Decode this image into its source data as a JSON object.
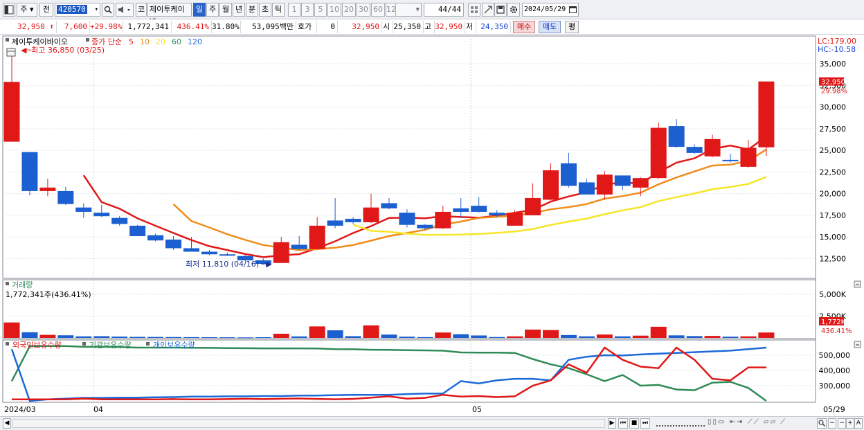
{
  "toolbar": {
    "market_label": "주",
    "prev_label": "전",
    "code": "420570",
    "stock_tag": "코",
    "stock_name": "제이투케이바",
    "periods": [
      {
        "label": "일",
        "selected": true
      },
      {
        "label": "주",
        "selected": false
      },
      {
        "label": "월",
        "selected": false
      },
      {
        "label": "년",
        "selected": false
      },
      {
        "label": "분",
        "selected": false
      },
      {
        "label": "초",
        "selected": false
      },
      {
        "label": "틱",
        "selected": false
      }
    ],
    "intervals": [
      "1",
      "3",
      "5",
      "10",
      "20",
      "30",
      "60",
      "120"
    ],
    "count": "44",
    "count_total": "/44",
    "date": "2024/05/29",
    "icons": [
      "window-icon",
      "search-icon",
      "speaker-icon",
      "grid-icon",
      "crosshair-icon",
      "save-icon",
      "gear-icon",
      "calendar-icon"
    ]
  },
  "info": {
    "price": "32,950",
    "change": "7,600",
    "change_pct": "+29.98%",
    "volume": "1,772,341",
    "volume_pct": "436.41%",
    "turnover": "31.80%",
    "amount": "53,095백만",
    "quote_label": "호가",
    "quote_value": "0",
    "quote_price": "32,950",
    "open_label": "시",
    "open": "25,350",
    "high_label": "고",
    "high": "32,950",
    "low_label": "저",
    "low": "24,350",
    "buy_label": "매수",
    "sell_label": "매도",
    "flat_label": "평"
  },
  "price_panel": {
    "legend_name": "제이투케이바이오",
    "legend_ma_label": "종가 단순",
    "ma_periods": [
      "5",
      "10",
      "20",
      "60",
      "120"
    ],
    "ma_colors": [
      "#e01818",
      "#f08c1c",
      "#f5e628",
      "#2e8b57",
      "#1c6ad8"
    ],
    "high_annotation": "최고 36,850 (03/25)",
    "low_annotation": "최저 11,810 (04/16)",
    "lc": "LC:179.00",
    "hc": "HC:-10.58",
    "axis_ticks": [
      "35,000",
      "32,500",
      "30,000",
      "27,500",
      "25,000",
      "22,500",
      "20,000",
      "17,500",
      "15,000",
      "12,500"
    ],
    "last_price_tag": "32,950",
    "last_pct_tag": "29.98%"
  },
  "volume_panel": {
    "title": "거래량",
    "value": "1,772,341주(436.41%)",
    "axis_ticks": [
      "5,000K",
      "2,500K"
    ],
    "last_tag": "1,772K",
    "last_pct_tag": "436.41%"
  },
  "holdings_panel": {
    "legends": [
      "외국인보유수량",
      "기관보유수량",
      "개인보유수량"
    ],
    "colors": [
      "#e01818",
      "#2e8b57",
      "#1c6ad8"
    ],
    "axis_ticks": [
      "500,000",
      "400,000",
      "300,000"
    ]
  },
  "x_axis": {
    "labels": [
      "2024/03",
      "04",
      "05"
    ],
    "last_label": "05/29"
  },
  "chart_data": {
    "type": "candlestick",
    "candles": [
      {
        "o": 26000,
        "h": 36850,
        "l": 26000,
        "c": 32900
      },
      {
        "o": 24800,
        "h": 24800,
        "l": 19800,
        "c": 20300
      },
      {
        "o": 20300,
        "h": 21700,
        "l": 19700,
        "c": 20700
      },
      {
        "o": 20300,
        "h": 20800,
        "l": 18700,
        "c": 18800
      },
      {
        "o": 18400,
        "h": 18900,
        "l": 17200,
        "c": 17900
      },
      {
        "o": 17800,
        "h": 18700,
        "l": 17300,
        "c": 17400
      },
      {
        "o": 17200,
        "h": 17400,
        "l": 16300,
        "c": 16500
      },
      {
        "o": 16300,
        "h": 16400,
        "l": 15100,
        "c": 15100
      },
      {
        "o": 15200,
        "h": 15400,
        "l": 14500,
        "c": 14600
      },
      {
        "o": 14700,
        "h": 15100,
        "l": 13500,
        "c": 13700
      },
      {
        "o": 13700,
        "h": 15000,
        "l": 13400,
        "c": 13300
      },
      {
        "o": 13300,
        "h": 13500,
        "l": 12900,
        "c": 13000
      },
      {
        "o": 13000,
        "h": 13200,
        "l": 12800,
        "c": 12850
      },
      {
        "o": 12800,
        "h": 12900,
        "l": 12200,
        "c": 12300
      },
      {
        "o": 12300,
        "h": 12500,
        "l": 11810,
        "c": 11900
      },
      {
        "o": 12000,
        "h": 15000,
        "l": 12000,
        "c": 14400
      },
      {
        "o": 14100,
        "h": 15100,
        "l": 13500,
        "c": 13600
      },
      {
        "o": 13600,
        "h": 17300,
        "l": 13600,
        "c": 16300
      },
      {
        "o": 16900,
        "h": 19500,
        "l": 16000,
        "c": 16300
      },
      {
        "o": 17100,
        "h": 17300,
        "l": 16500,
        "c": 16700
      },
      {
        "o": 16700,
        "h": 20000,
        "l": 16600,
        "c": 18400
      },
      {
        "o": 18900,
        "h": 19500,
        "l": 18200,
        "c": 18300
      },
      {
        "o": 17800,
        "h": 18200,
        "l": 16100,
        "c": 16400
      },
      {
        "o": 16400,
        "h": 16500,
        "l": 15800,
        "c": 16000
      },
      {
        "o": 16000,
        "h": 18600,
        "l": 15900,
        "c": 17900
      },
      {
        "o": 18300,
        "h": 19500,
        "l": 17200,
        "c": 17900
      },
      {
        "o": 18600,
        "h": 19600,
        "l": 17800,
        "c": 17900
      },
      {
        "o": 17800,
        "h": 18100,
        "l": 17300,
        "c": 17500
      },
      {
        "o": 16300,
        "h": 18100,
        "l": 16300,
        "c": 17800
      },
      {
        "o": 17500,
        "h": 21200,
        "l": 17500,
        "c": 19500
      },
      {
        "o": 19300,
        "h": 23500,
        "l": 19200,
        "c": 22700
      },
      {
        "o": 23500,
        "h": 24700,
        "l": 20700,
        "c": 20900
      },
      {
        "o": 21300,
        "h": 21700,
        "l": 19900,
        "c": 19900
      },
      {
        "o": 19900,
        "h": 22600,
        "l": 19300,
        "c": 22200
      },
      {
        "o": 22100,
        "h": 22100,
        "l": 20400,
        "c": 20900
      },
      {
        "o": 20700,
        "h": 21900,
        "l": 19700,
        "c": 21800
      },
      {
        "o": 21800,
        "h": 28200,
        "l": 21700,
        "c": 27600
      },
      {
        "o": 27800,
        "h": 28600,
        "l": 25300,
        "c": 25400
      },
      {
        "o": 25400,
        "h": 25700,
        "l": 24600,
        "c": 24700
      },
      {
        "o": 24300,
        "h": 26800,
        "l": 24200,
        "c": 26300
      },
      {
        "o": 23900,
        "h": 24600,
        "l": 23600,
        "c": 23800
      },
      {
        "o": 23100,
        "h": 26200,
        "l": 23000,
        "c": 25300
      },
      {
        "o": 25350,
        "h": 32950,
        "l": 24350,
        "c": 32950
      }
    ],
    "volume_k": [
      1772,
      650,
      350,
      300,
      180,
      200,
      150,
      120,
      110,
      100,
      90,
      80,
      70,
      60,
      80,
      480,
      170,
      1320,
      870,
      200,
      1430,
      380,
      140,
      90,
      620,
      420,
      280,
      100,
      180,
      950,
      900,
      330,
      180,
      390,
      180,
      260,
      1280,
      290,
      210,
      230,
      140,
      180,
      620
    ],
    "volume_up": [
      true,
      false,
      true,
      false,
      false,
      false,
      false,
      false,
      false,
      false,
      false,
      false,
      false,
      false,
      false,
      true,
      false,
      true,
      false,
      false,
      true,
      false,
      false,
      false,
      true,
      false,
      false,
      false,
      true,
      true,
      true,
      false,
      false,
      true,
      false,
      true,
      true,
      false,
      false,
      true,
      false,
      true,
      true
    ],
    "foreign": [
      210,
      210,
      210,
      210,
      215,
      210,
      210,
      210,
      210,
      212,
      210,
      210,
      212,
      214,
      212,
      214,
      216,
      213,
      211,
      213,
      222,
      230,
      215,
      220,
      240,
      228,
      232,
      225,
      230,
      300,
      335,
      440,
      385,
      550,
      470,
      425,
      415,
      550,
      470,
      345,
      335,
      420,
      420
    ],
    "institution": [
      330,
      560,
      560,
      560,
      555,
      555,
      553,
      550,
      550,
      550,
      549,
      548,
      547,
      546,
      545,
      545,
      545,
      544,
      540,
      539,
      536,
      535,
      533,
      532,
      530,
      518,
      517,
      517,
      515,
      475,
      440,
      415,
      375,
      330,
      370,
      300,
      305,
      275,
      270,
      320,
      325,
      285,
      200
    ],
    "individual": [
      540,
      200,
      210,
      215,
      220,
      220,
      222,
      222,
      224,
      225,
      228,
      228,
      230,
      230,
      232,
      232,
      235,
      235,
      238,
      240,
      240,
      240,
      245,
      248,
      248,
      330,
      315,
      335,
      345,
      345,
      335,
      470,
      490,
      500,
      498,
      505,
      510,
      515,
      520,
      525,
      530,
      540,
      550
    ]
  }
}
